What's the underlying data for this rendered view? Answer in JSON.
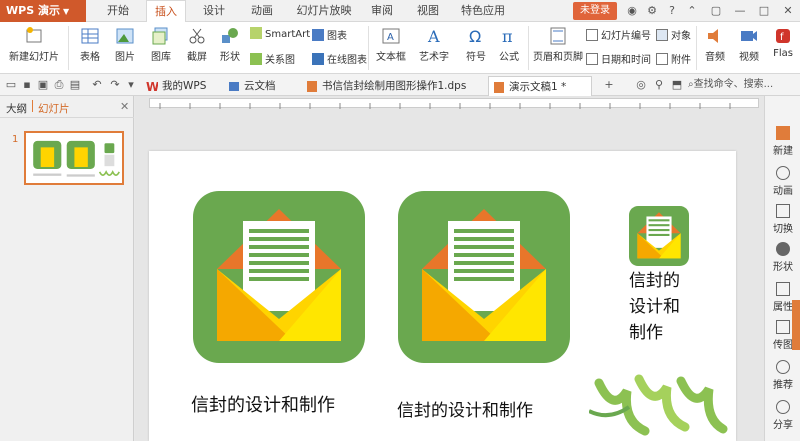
{
  "app": {
    "name": "WPS 演示"
  },
  "menu_tabs": [
    "开始",
    "插入",
    "设计",
    "动画",
    "幻灯片放映",
    "审阅",
    "视图",
    "特色应用"
  ],
  "active_tab": "插入",
  "login_label": "未登录",
  "ribbon": {
    "new_slide": "新建幻灯片",
    "table": "表格",
    "picture": "图片",
    "gallery": "图库",
    "screenshot": "截屏",
    "shape": "形状",
    "smartart": "SmartArt",
    "chart": "图表",
    "relation": "关系图",
    "online_chart": "在线图表",
    "textbox": "文本框",
    "wordart": "艺术字",
    "symbol": "符号",
    "formula": "公式",
    "header_footer": "页眉和页脚",
    "slide_number": "幻灯片编号",
    "object": "对象",
    "datetime": "日期和时间",
    "attachment": "附件",
    "audio": "音频",
    "video": "视频",
    "flash": "Flas"
  },
  "doc_tabs": [
    "我的WPS",
    "云文档",
    "书信信封绘制用图形操作1.dps",
    "演示文稿1 *"
  ],
  "search_placeholder": "查找命令、搜索...",
  "panel": {
    "tab_outline": "大纲",
    "tab_slides": "幻灯片"
  },
  "slide_number": "1",
  "slide": {
    "caption_large": "信封的设计和制作",
    "caption_mid": "信封的设计和制作",
    "caption_small": [
      "信封的",
      "设计和",
      "制作"
    ]
  },
  "right_rail": [
    "新建",
    "动画",
    "切换",
    "形状",
    "属性",
    "传图",
    "推荐",
    "分享"
  ],
  "colors": {
    "app_orange": "#d0592b",
    "envelope_bg": "#6aa84f",
    "envelope_body": "#ffd400",
    "envelope_left": "#f5a800",
    "envelope_flap": "#e8762a",
    "letter_lines": "#6aa84f"
  }
}
